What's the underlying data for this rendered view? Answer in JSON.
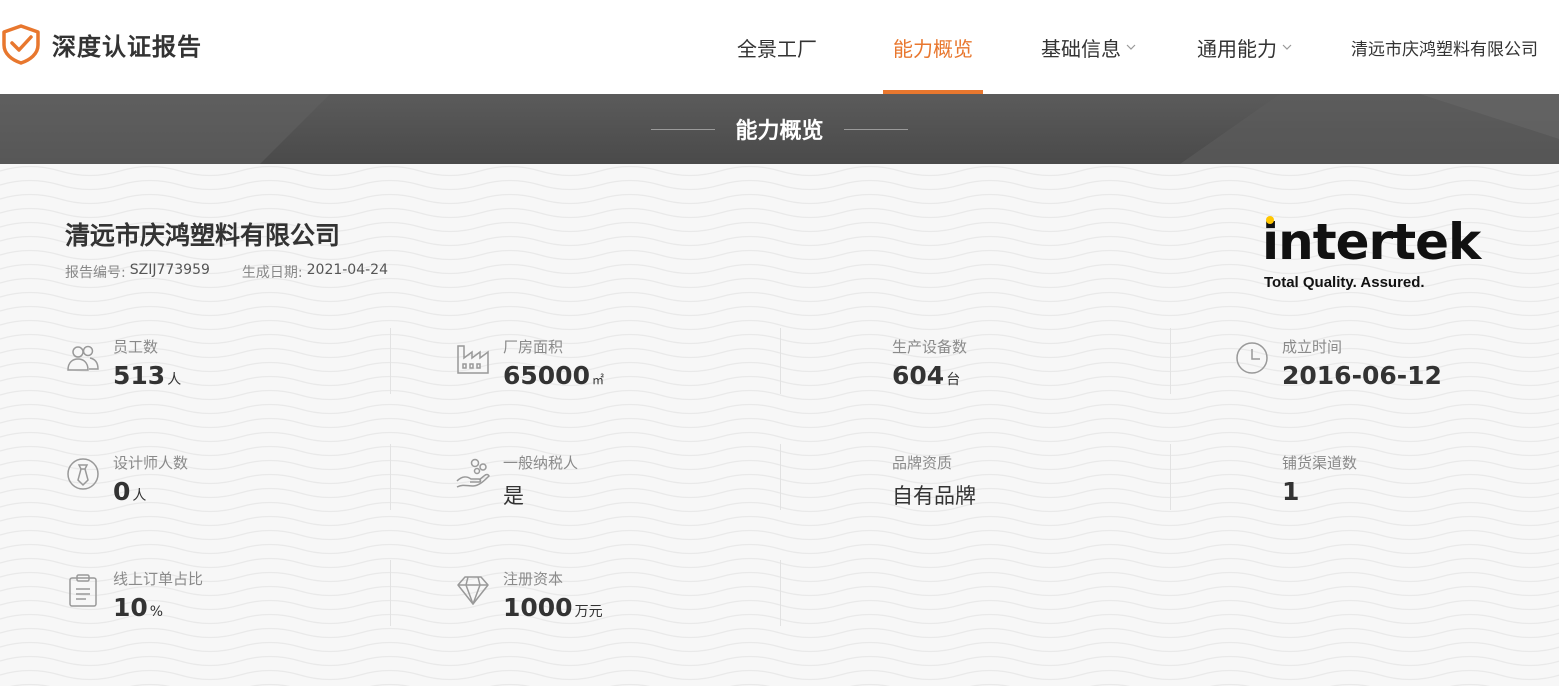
{
  "header": {
    "brand_title": "深度认证报告",
    "nav": [
      {
        "label": "全景工厂",
        "active": false,
        "dropdown": false
      },
      {
        "label": "能力概览",
        "active": true,
        "dropdown": false
      },
      {
        "label": "基础信息",
        "active": false,
        "dropdown": true
      },
      {
        "label": "通用能力",
        "active": false,
        "dropdown": true
      }
    ],
    "company_link": "清远市庆鸿塑料有限公司"
  },
  "banner": {
    "title": "能力概览"
  },
  "company": {
    "name": "清远市庆鸿塑料有限公司",
    "report_no_label": "报告编号:",
    "report_no": "SZIJ773959",
    "date_label": "生成日期:",
    "date": "2021-04-24"
  },
  "logo": {
    "word": "intertek",
    "tagline": "Total Quality. Assured."
  },
  "stats": {
    "employees": {
      "label": "员工数",
      "value": "513",
      "unit": "人",
      "icon": "people-icon"
    },
    "area": {
      "label": "厂房面积",
      "value": "65000",
      "unit": "㎡",
      "icon": "factory-icon"
    },
    "equipment": {
      "label": "生产设备数",
      "value": "604",
      "unit": "台",
      "icon": ""
    },
    "founded": {
      "label": "成立时间",
      "value": "2016-06-12",
      "unit": "",
      "icon": "clock-icon"
    },
    "designers": {
      "label": "设计师人数",
      "value": "0",
      "unit": "人",
      "icon": "tie-icon"
    },
    "taxpayer": {
      "label": "一般纳税人",
      "value": "是",
      "unit": "",
      "icon": "hand-coins-icon"
    },
    "brand": {
      "label": "品牌资质",
      "value": "自有品牌",
      "unit": "",
      "icon": ""
    },
    "channels": {
      "label": "铺货渠道数",
      "value": "1",
      "unit": "",
      "icon": ""
    },
    "online_orders": {
      "label": "线上订单占比",
      "value": "10",
      "unit": "%",
      "icon": "clipboard-icon"
    },
    "capital": {
      "label": "注册资本",
      "value": "1000",
      "unit": "万元",
      "icon": "diamond-icon"
    }
  },
  "colors": {
    "accent": "#e8772e",
    "banner": "#555555",
    "text": "#333333",
    "label": "#8a8a8a"
  }
}
